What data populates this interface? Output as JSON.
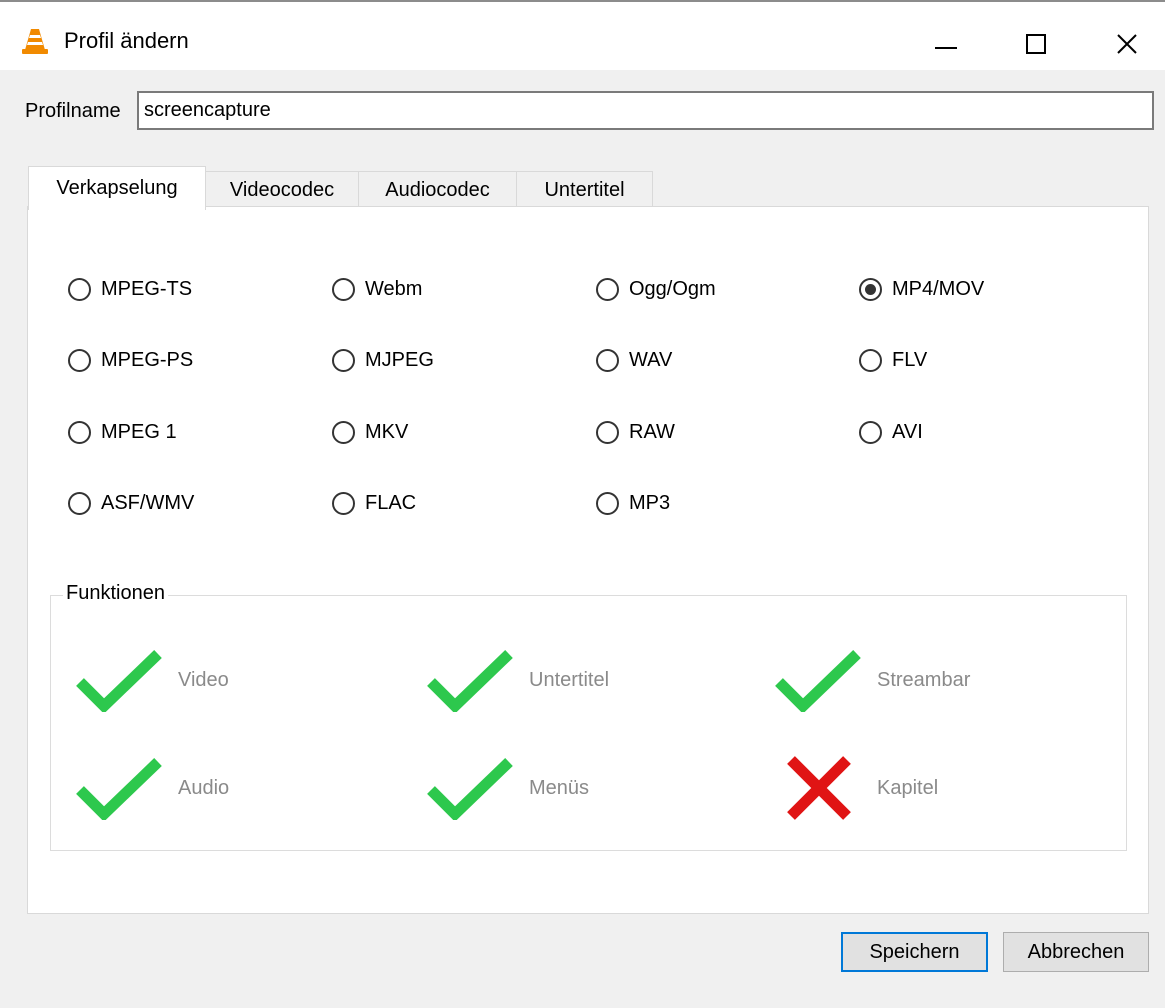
{
  "window": {
    "title": "Profil ändern",
    "icon": "vlc-cone-icon",
    "controls": [
      "minimize",
      "maximize",
      "close"
    ]
  },
  "profile": {
    "label": "Profilname",
    "value": "screencapture"
  },
  "tabs": [
    {
      "label": "Verkapselung",
      "active": true
    },
    {
      "label": "Videocodec",
      "active": false
    },
    {
      "label": "Audiocodec",
      "active": false
    },
    {
      "label": "Untertitel",
      "active": false
    }
  ],
  "encapsulation": [
    {
      "label": "MPEG-TS",
      "checked": false
    },
    {
      "label": "Webm",
      "checked": false
    },
    {
      "label": "Ogg/Ogm",
      "checked": false
    },
    {
      "label": "MP4/MOV",
      "checked": true
    },
    {
      "label": "MPEG-PS",
      "checked": false
    },
    {
      "label": "MJPEG",
      "checked": false
    },
    {
      "label": "WAV",
      "checked": false
    },
    {
      "label": "FLV",
      "checked": false
    },
    {
      "label": "MPEG 1",
      "checked": false
    },
    {
      "label": "MKV",
      "checked": false
    },
    {
      "label": "RAW",
      "checked": false
    },
    {
      "label": "AVI",
      "checked": false
    },
    {
      "label": "ASF/WMV",
      "checked": false
    },
    {
      "label": "FLAC",
      "checked": false
    },
    {
      "label": "MP3",
      "checked": false
    }
  ],
  "functions": {
    "title": "Funktionen",
    "items": [
      {
        "label": "Video",
        "supported": true
      },
      {
        "label": "Untertitel",
        "supported": true
      },
      {
        "label": "Streambar",
        "supported": true
      },
      {
        "label": "Audio",
        "supported": true
      },
      {
        "label": "Menüs",
        "supported": true
      },
      {
        "label": "Kapitel",
        "supported": false
      }
    ]
  },
  "colors": {
    "check": "#2dc84d",
    "cross": "#e01414",
    "accent": "#0078d7"
  },
  "buttons": {
    "save": "Speichern",
    "cancel": "Abbrechen"
  }
}
